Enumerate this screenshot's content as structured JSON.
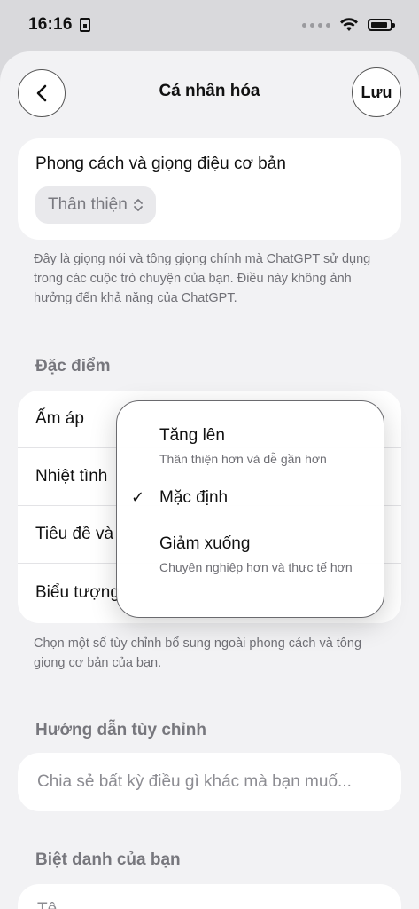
{
  "status": {
    "time": "16:16"
  },
  "nav": {
    "title": "Cá nhân hóa",
    "save_label": "Lưu",
    "back_icon": "‹"
  },
  "tone": {
    "label": "Phong cách và giọng điệu cơ bản",
    "value": "Thân thiện",
    "helper": "Đây là giọng nói và tông giọng chính mà ChatGPT sử dụng trong các cuộc trò chuyện của bạn. Điều này không ảnh hưởng đến khả năng của ChatGPT."
  },
  "traits": {
    "heading": "Đặc điểm",
    "items": [
      {
        "label": "Ấm áp"
      },
      {
        "label": "Nhiệt tình"
      },
      {
        "label": "Tiêu đề và"
      },
      {
        "label": "Biểu tượng"
      }
    ],
    "helper": "Chọn một số tùy chỉnh bổ sung ngoài phong cách và tông giọng cơ bản của bạn."
  },
  "dropdown": {
    "options": [
      {
        "title": "Tăng lên",
        "subtitle": "Thân thiện hơn và dễ gần hơn"
      },
      {
        "title": "Mặc định",
        "subtitle": "",
        "selected": true
      },
      {
        "title": "Giảm xuống",
        "subtitle": "Chuyên nghiệp hơn và thực tế hơn"
      }
    ],
    "check_icon": "✓"
  },
  "custom": {
    "heading": "Hướng dẫn tùy chỉnh",
    "placeholder": "Chia sẻ bất kỳ điều gì khác mà bạn muố..."
  },
  "nickname": {
    "heading": "Biệt danh của bạn",
    "placeholder": "Tê..."
  }
}
